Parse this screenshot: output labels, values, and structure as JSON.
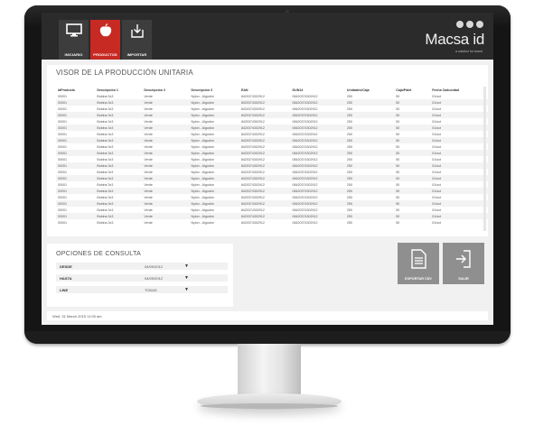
{
  "header": {
    "tabs": [
      {
        "label": "INICIARIO",
        "icon": "monitor-icon",
        "active": false
      },
      {
        "label": "PRODUCTOS",
        "icon": "apple-icon",
        "active": true
      },
      {
        "label": "IMPORTAR",
        "icon": "download-icon",
        "active": false
      }
    ],
    "logo": "Macsa id",
    "logo_sub": "a solution for brand",
    "accent": "#c62a22"
  },
  "viewer": {
    "title": "VISOR DE LA PRODUCCIÓN UNITARIA",
    "columns": [
      "IdProducto",
      "Descripción 1",
      "Descripción 2",
      "Descripción 3",
      "EAN",
      "DUN14",
      "Unidades/Caja",
      "Caja/Palet",
      "Fecha Caducidad"
    ],
    "rows": [
      [
        "00001",
        "Bobina 3x3",
        "Verde",
        "Nylon - Algodón",
        "8420374302912",
        "08420374302912",
        "250",
        "50",
        "01/oct"
      ],
      [
        "00001",
        "Bobina 3x3",
        "Verde",
        "Nylon - Algodón",
        "8420374302912",
        "08420374302912",
        "250",
        "50",
        "01/oct"
      ],
      [
        "00001",
        "Bobina 3x3",
        "Verde",
        "Nylon - Algodón",
        "8420374302912",
        "08420374302912",
        "250",
        "50",
        "01/oct"
      ],
      [
        "00001",
        "Bobina 3x3",
        "Verde",
        "Nylon - Algodón",
        "8420374302912",
        "08420374302912",
        "250",
        "50",
        "01/oct"
      ],
      [
        "00001",
        "Bobina 3x3",
        "Verde",
        "Nylon - Algodón",
        "8420374302912",
        "08420374302912",
        "250",
        "50",
        "01/oct"
      ],
      [
        "00001",
        "Bobina 3x3",
        "Verde",
        "Nylon - Algodón",
        "8420374302912",
        "08420374302912",
        "250",
        "50",
        "01/oct"
      ],
      [
        "00001",
        "Bobina 3x3",
        "Verde",
        "Nylon - Algodón",
        "8420374302912",
        "08420374302912",
        "250",
        "50",
        "01/oct"
      ],
      [
        "00001",
        "Bobina 3x3",
        "Verde",
        "Nylon - Algodón",
        "8420374302912",
        "08420374302912",
        "250",
        "50",
        "01/oct"
      ],
      [
        "00001",
        "Bobina 3x3",
        "Verde",
        "Nylon - Algodón",
        "8420374302912",
        "08420374302912",
        "250",
        "50",
        "01/oct"
      ],
      [
        "00001",
        "Bobina 3x3",
        "Verde",
        "Nylon - Algodón",
        "8420374302912",
        "08420374302912",
        "250",
        "50",
        "01/oct"
      ],
      [
        "00001",
        "Bobina 3x3",
        "Verde",
        "Nylon - Algodón",
        "8420374302912",
        "08420374302912",
        "250",
        "50",
        "01/oct"
      ],
      [
        "00001",
        "Bobina 3x3",
        "Verde",
        "Nylon - Algodón",
        "8420374302912",
        "08420374302912",
        "250",
        "50",
        "01/oct"
      ],
      [
        "00001",
        "Bobina 3x3",
        "Verde",
        "Nylon - Algodón",
        "8420374302912",
        "08420374302912",
        "250",
        "50",
        "01/oct"
      ],
      [
        "00001",
        "Bobina 3x3",
        "Verde",
        "Nylon - Algodón",
        "8420374302912",
        "08420374302912",
        "250",
        "50",
        "01/oct"
      ],
      [
        "00001",
        "Bobina 3x3",
        "Verde",
        "Nylon - Algodón",
        "8420374302912",
        "08420374302912",
        "250",
        "50",
        "01/oct"
      ],
      [
        "00001",
        "Bobina 3x3",
        "Verde",
        "Nylon - Algodón",
        "8420374302912",
        "08420374302912",
        "250",
        "50",
        "01/oct"
      ],
      [
        "00001",
        "Bobina 3x3",
        "Verde",
        "Nylon - Algodón",
        "8420374302912",
        "08420374302912",
        "250",
        "50",
        "01/oct"
      ],
      [
        "00001",
        "Bobina 3x3",
        "Verde",
        "Nylon - Algodón",
        "8420374302912",
        "08420374302912",
        "250",
        "50",
        "01/oct"
      ],
      [
        "00001",
        "Bobina 3x3",
        "Verde",
        "Nylon - Algodón",
        "8420374302912",
        "08420374302912",
        "250",
        "50",
        "01/oct"
      ],
      [
        "00001",
        "Bobina 3x3",
        "Verde",
        "Nylon - Algodón",
        "8420374302912",
        "08420374302912",
        "250",
        "50",
        "01/oct"
      ],
      [
        "00001",
        "Bobina 3x3",
        "Verde",
        "Nylon - Algodón",
        "8420374302912",
        "08420374302912",
        "250",
        "50",
        "01/oct"
      ]
    ]
  },
  "options": {
    "title": "OPCIONES DE CONSULTA",
    "fields": [
      {
        "label": "DESDE",
        "value": "04/09/2012"
      },
      {
        "label": "HASTA",
        "value": "04/09/2012"
      },
      {
        "label": "LINE",
        "value": "TODAS"
      }
    ]
  },
  "actions": {
    "export_label": "EXPORTAR CSV",
    "exit_label": "SALIR"
  },
  "status": {
    "text": "Wed, 31 March 2015 11:05 am"
  }
}
